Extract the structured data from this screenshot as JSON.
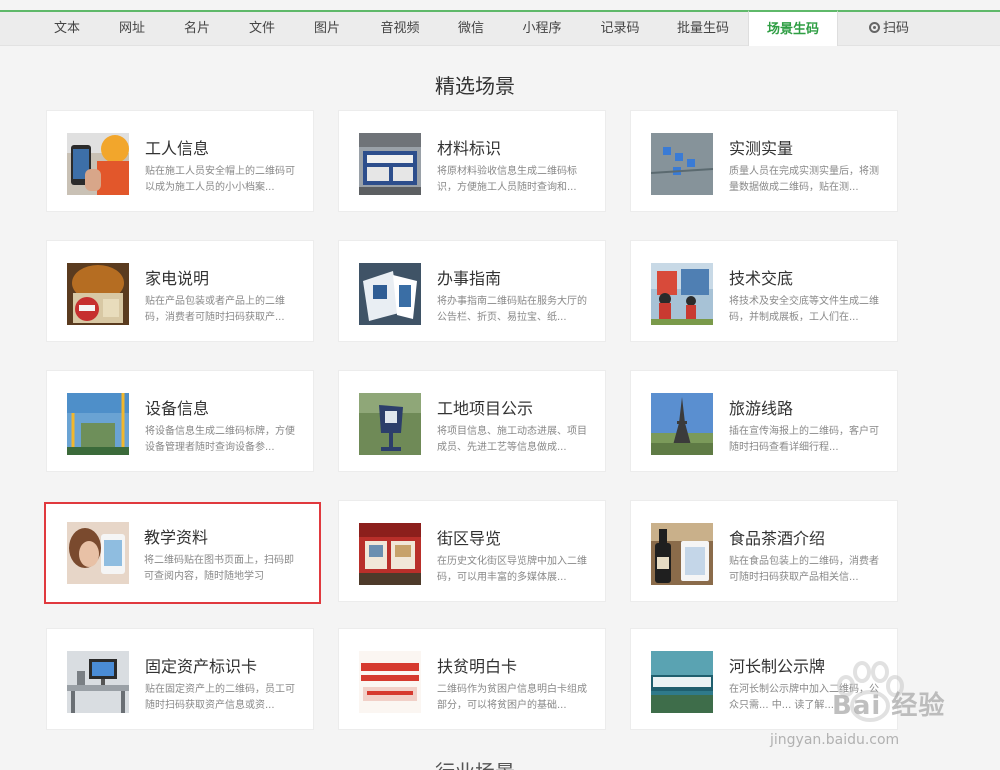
{
  "nav": {
    "tabs": [
      {
        "label": "文本",
        "active": false
      },
      {
        "label": "网址",
        "active": false
      },
      {
        "label": "名片",
        "active": false
      },
      {
        "label": "文件",
        "active": false
      },
      {
        "label": "图片",
        "active": false
      },
      {
        "label": "音视频",
        "active": false
      },
      {
        "label": "微信",
        "active": false
      },
      {
        "label": "小程序",
        "active": false
      },
      {
        "label": "记录码",
        "active": false
      },
      {
        "label": "批量生码",
        "active": false
      },
      {
        "label": "场景生码",
        "active": true
      },
      {
        "label": "扫码",
        "active": false,
        "icon": "camera-scan-icon"
      }
    ]
  },
  "section": {
    "title": "精选场景",
    "next_title": "行业场景"
  },
  "cards": [
    {
      "title": "工人信息",
      "desc": "贴在施工人员安全帽上的二维码可以成为施工人员的小小档案...",
      "icon": "worker-photo-thumbnail"
    },
    {
      "title": "材料标识",
      "desc": "将原材料验收信息生成二维码标识，方便施工人员随时查询和...",
      "icon": "material-label-thumbnail"
    },
    {
      "title": "实测实量",
      "desc": "质量人员在完成实测实量后，将测量数据做成二维码，贴在测...",
      "icon": "measurement-thumbnail"
    },
    {
      "title": "家电说明",
      "desc": "贴在产品包装或者产品上的二维码，消费者可随时扫码获取产...",
      "icon": "appliance-thumbnail"
    },
    {
      "title": "办事指南",
      "desc": "将办事指南二维码贴在服务大厅的公告栏、折页、易拉宝、纸...",
      "icon": "service-guide-thumbnail"
    },
    {
      "title": "技术交底",
      "desc": "将技术及安全交底等文件生成二维码，并制成展板，工人们在...",
      "icon": "technical-briefing-thumbnail"
    },
    {
      "title": "设备信息",
      "desc": "将设备信息生成二维码标牌，方便设备管理者随时查询设备参...",
      "icon": "equipment-thumbnail"
    },
    {
      "title": "工地项目公示",
      "desc": "将项目信息、施工动态进展、项目成员、先进工艺等信息做成...",
      "icon": "site-project-thumbnail"
    },
    {
      "title": "旅游线路",
      "desc": "插在宣传海报上的二维码，客户可随时扫码查看详细行程...",
      "icon": "eiffel-tower-thumbnail"
    },
    {
      "title": "教学资料",
      "desc": "将二维码贴在图书页面上，扫码即可查阅内容，随时随地学习",
      "icon": "teaching-material-thumbnail"
    },
    {
      "title": "街区导览",
      "desc": "在历史文化街区导览牌中加入二维码，可以用丰富的多媒体展...",
      "icon": "street-guide-thumbnail"
    },
    {
      "title": "食品茶酒介绍",
      "desc": "贴在食品包装上的二维码，消费者可随时扫码获取产品相关信...",
      "icon": "wine-bottle-thumbnail"
    },
    {
      "title": "固定资产标识卡",
      "desc": "贴在固定资产上的二维码，员工可随时扫码获取资产信息或资...",
      "icon": "office-desk-thumbnail"
    },
    {
      "title": "扶贫明白卡",
      "desc": "二维码作为贫困户信息明白卡组成部分，可以将贫困户的基础...",
      "icon": "poverty-card-thumbnail"
    },
    {
      "title": "河长制公示牌",
      "desc": "在河长制公示牌中加入二维码，公众只需... 中... 读了解...",
      "icon": "river-chief-thumbnail"
    }
  ],
  "watermark": {
    "text": "Bai 经验",
    "url": "jingyan.baidu.com"
  }
}
